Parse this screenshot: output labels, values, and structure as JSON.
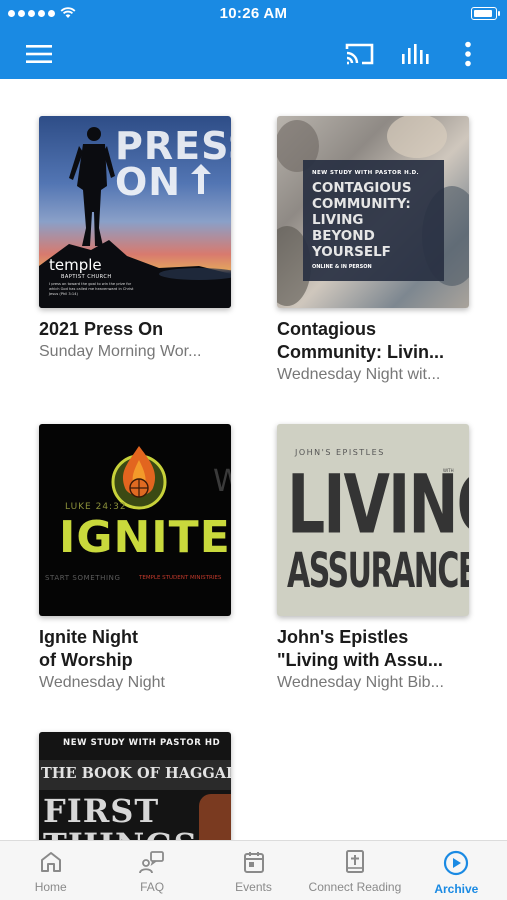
{
  "status": {
    "time": "10:26 AM"
  },
  "appbar": {
    "menu_icon": "hamburger-icon",
    "cast_icon": "cast-icon",
    "chart_icon": "bars-icon",
    "more_icon": "kebab-icon"
  },
  "colors": {
    "primary": "#1a8ae3",
    "title": "#1b1b1b",
    "subtitle": "#777777",
    "tab_inactive": "#8a8a8a"
  },
  "items": [
    {
      "title": "2021 Press On",
      "subtitle": "Sunday Morning Wor...",
      "art": {
        "headline": "PRESS",
        "headline2": "ON",
        "logo": "temple",
        "logo_sub": "BAPTIST CHURCH",
        "verse": "I press on toward the goal to win the prize for which God has called me heavenward in Christ Jesus (Phil 3:14)"
      }
    },
    {
      "title": "Contagious",
      "title2": "Community: Livin...",
      "subtitle": "Wednesday Night wit...",
      "art": {
        "kicker": "NEW STUDY WITH PASTOR H.D.",
        "lines": [
          "CONTAGIOUS",
          "COMMUNITY:",
          "LIVING",
          "BEYOND",
          "YOURSELF"
        ],
        "footer": "ONLINE & IN PERSON"
      }
    },
    {
      "title": "Ignite Night",
      "title2": "of Worship",
      "subtitle": "Wednesday Night",
      "art": {
        "ref": "LUKE 24:32",
        "headline": "IGNITE",
        "left": "START SOMETHING",
        "right": "TEMPLE STUDENT MINISTRIES",
        "edge": "W"
      }
    },
    {
      "title": "John's Epistles",
      "title2": "\"Living with Assu...",
      "subtitle": "Wednesday Night Bib...",
      "art": {
        "kicker": "JOHN'S EPISTLES",
        "line1": "LIVING",
        "with": "WITH",
        "line2": "ASSURANCE"
      }
    },
    {
      "title": "",
      "subtitle": "",
      "art": {
        "kicker": "NEW STUDY WITH PASTOR HD",
        "line1": "THE BOOK OF HAGGAI",
        "line2": "FIRST",
        "line3": "THINGS"
      }
    }
  ],
  "tabs": [
    {
      "label": "Home",
      "icon": "home-icon"
    },
    {
      "label": "FAQ",
      "icon": "faq-icon"
    },
    {
      "label": "Events",
      "icon": "calendar-icon"
    },
    {
      "label": "Connect Reading",
      "icon": "bible-icon"
    },
    {
      "label": "Archive",
      "icon": "play-circle-icon",
      "active": true
    }
  ]
}
